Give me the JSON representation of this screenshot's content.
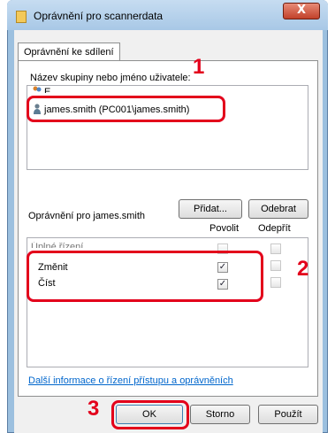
{
  "window": {
    "title": "Oprávnění pro scannerdata",
    "close_glyph": "X"
  },
  "tab": {
    "label": "Oprávnění ke sdílení"
  },
  "groups": {
    "label": "Název skupiny nebo jméno uživatele:",
    "items": [
      {
        "label": "E",
        "icon": "group-icon"
      },
      {
        "label": "james.smith (PC001\\james.smith)",
        "icon": "user-icon",
        "selected": true
      }
    ]
  },
  "buttons": {
    "add": "Přidat...",
    "remove": "Odebrat",
    "ok": "OK",
    "cancel": "Storno",
    "apply": "Použít"
  },
  "permissions": {
    "label": "Oprávnění pro james.smith",
    "allow_header": "Povolit",
    "deny_header": "Odepřít",
    "rows": [
      {
        "label": "Úplné řízení",
        "allow": false,
        "deny": false
      },
      {
        "label": "Změnit",
        "allow": true,
        "deny": false
      },
      {
        "label": "Číst",
        "allow": true,
        "deny": false
      }
    ]
  },
  "link": "Další informace o řízení přístupu a oprávněních",
  "callouts": [
    "1",
    "2",
    "3"
  ],
  "colors": {
    "callout": "#e3001b",
    "link": "#0066cc"
  }
}
